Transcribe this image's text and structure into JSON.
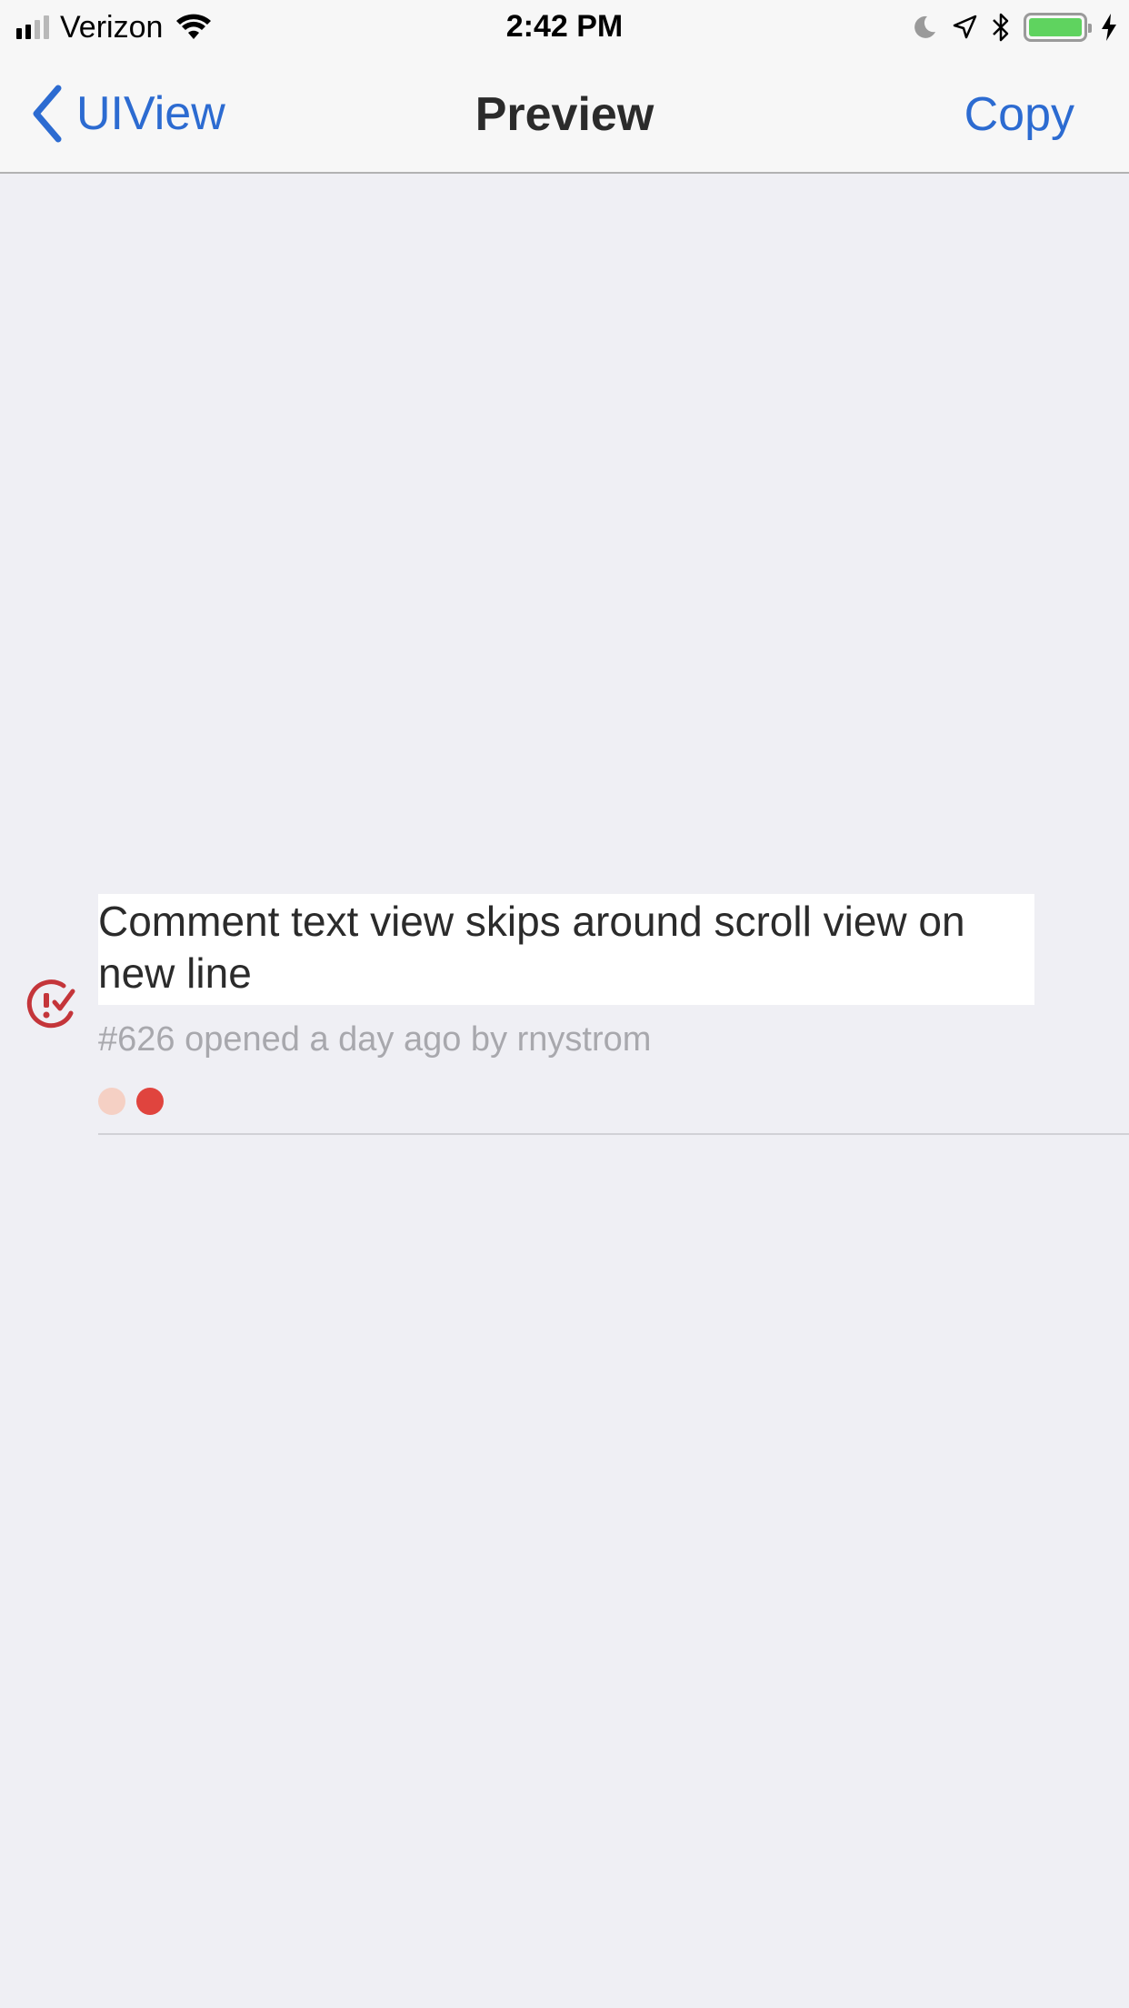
{
  "status_bar": {
    "carrier": "Verizon",
    "time": "2:42 PM",
    "signal_bars_filled": 2,
    "signal_bars_total": 4,
    "battery_level": 1.0,
    "icons": [
      "signal-icon",
      "wifi-icon",
      "moon-icon",
      "location-icon",
      "bluetooth-icon",
      "battery-icon",
      "charging-icon"
    ]
  },
  "nav": {
    "back_label": "UIView",
    "title": "Preview",
    "copy_label": "Copy"
  },
  "issue": {
    "title": "Comment text view skips around scroll view on new line",
    "meta": "#626 opened a day ago by rnystrom",
    "icon": "issue-status-icon",
    "label_colors": [
      "#f5d0c4",
      "#e0443e"
    ]
  },
  "colors": {
    "accent": "#2c6bd1",
    "issue_icon": "#c4353a",
    "background": "#efeff4",
    "battery": "#5fd35f"
  }
}
